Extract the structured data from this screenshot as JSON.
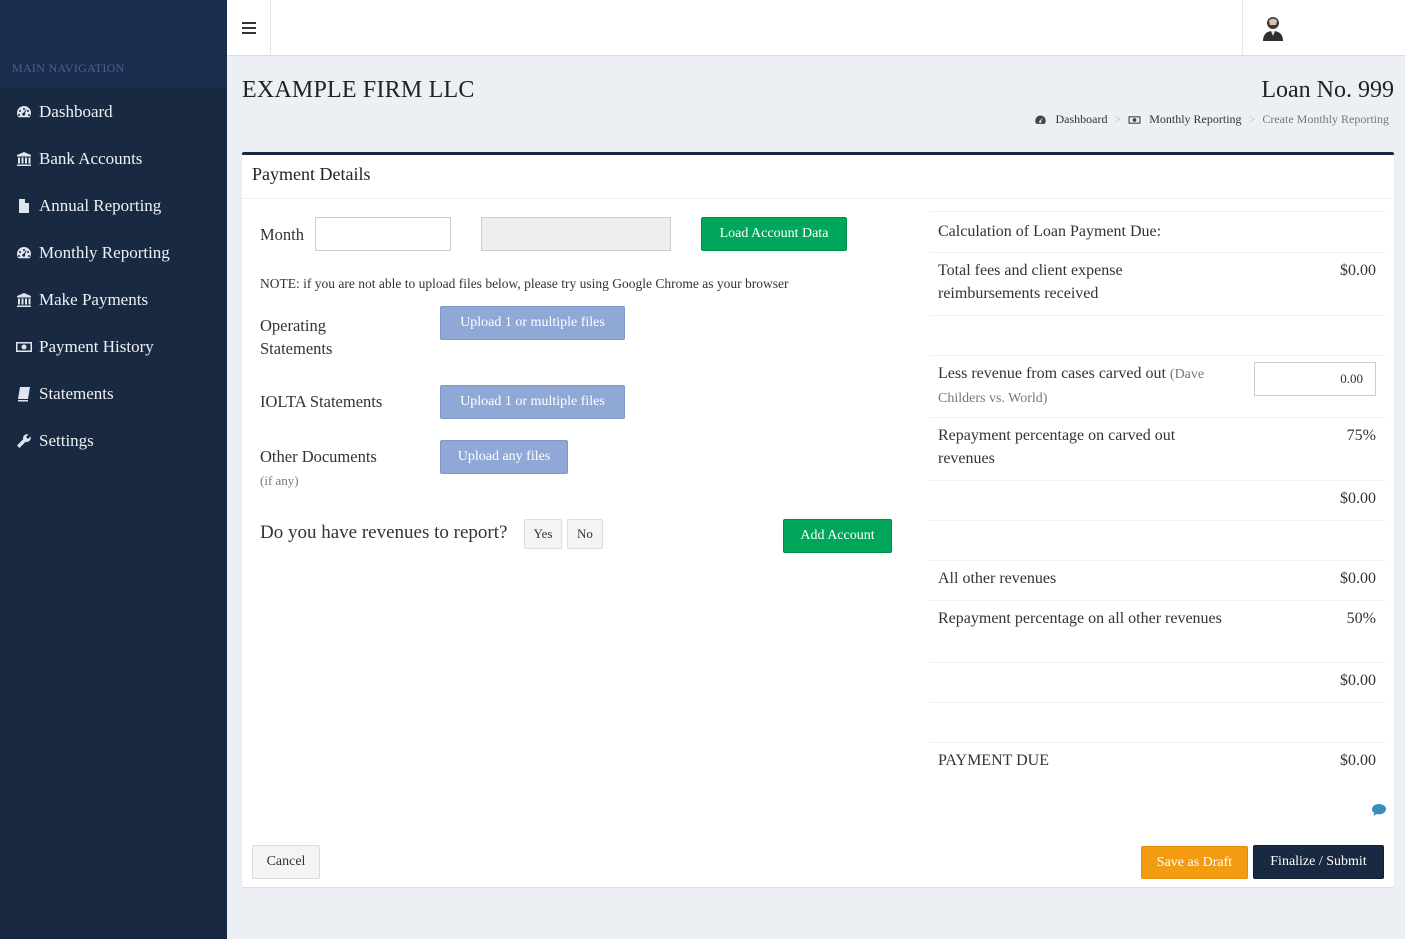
{
  "sidebar": {
    "header": "MAIN NAVIGATION",
    "items": [
      {
        "label": "Dashboard",
        "icon": "dashboard-icon"
      },
      {
        "label": "Bank Accounts",
        "icon": "bank-icon"
      },
      {
        "label": "Annual Reporting",
        "icon": "file-icon"
      },
      {
        "label": "Monthly Reporting",
        "icon": "dashboard-icon"
      },
      {
        "label": "Make Payments",
        "icon": "bank-icon"
      },
      {
        "label": "Payment History",
        "icon": "money-icon"
      },
      {
        "label": "Statements",
        "icon": "book-icon"
      },
      {
        "label": "Settings",
        "icon": "wrench-icon"
      }
    ]
  },
  "header": {
    "firm_name": "EXAMPLE FIRM LLC",
    "loan_no": "Loan No. 999",
    "breadcrumb": [
      {
        "label": "Dashboard",
        "icon": "dashboard-icon"
      },
      {
        "label": "Monthly Reporting",
        "icon": "money-icon"
      },
      {
        "label": "Create Monthly Reporting"
      }
    ],
    "separator": ">"
  },
  "box": {
    "title": "Payment Details",
    "month_label": "Month",
    "month_value": "",
    "load_button": "Load Account Data",
    "note": "NOTE: if you are not able to upload files below, please try using Google Chrome as your browser",
    "operating_label": "Operating Statements",
    "operating_button": "Upload 1 or multiple files",
    "iolta_label": "IOLTA Statements",
    "iolta_button": "Upload 1 or multiple files",
    "other_label": "Other Documents",
    "other_sub": "(if any)",
    "other_button": "Upload any files",
    "revenues_question": "Do you have revenues to report?",
    "yes": "Yes",
    "no": "No",
    "add_account": "Add Account",
    "cancel": "Cancel",
    "save_draft": "Save as Draft",
    "finalize": "Finalize / Submit"
  },
  "calc": {
    "title": "Calculation of Loan Payment Due:",
    "total_fees_label": "Total fees and client expense reimbursements received",
    "total_fees_value": "$0.00",
    "less_revenue_label": "Less revenue from cases carved out",
    "less_revenue_note": "(Dave Childers vs. World)",
    "less_revenue_input": "0.00",
    "repay_carved_label": "Repayment percentage on carved out revenues",
    "repay_carved_value": "75%",
    "carved_subtotal": "$0.00",
    "other_revenues_label": "All other revenues",
    "other_revenues_value": "$0.00",
    "repay_other_label": "Repayment percentage on all other revenues",
    "repay_other_value": "50%",
    "other_subtotal": "$0.00",
    "payment_due_label": "PAYMENT DUE",
    "payment_due_value": "$0.00"
  }
}
